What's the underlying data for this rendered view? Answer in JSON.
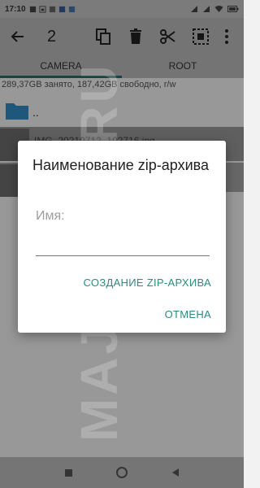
{
  "status_bar": {
    "time": "17:10",
    "icons": [
      "notification-icon",
      "calendar-icon",
      "image-icon",
      "facebook-icon",
      "vk-icon"
    ],
    "right_icons": [
      "signal-icon",
      "signal-icon",
      "wifi-icon",
      "battery-icon"
    ]
  },
  "toolbar": {
    "selected_count": "2",
    "icons": [
      "back-arrow-icon",
      "copy-icon",
      "delete-icon",
      "cut-icon",
      "select-all-icon",
      "more-vert-icon"
    ]
  },
  "tabs": [
    {
      "label": "CAMERA",
      "active": true
    },
    {
      "label": "ROOT",
      "active": false
    }
  ],
  "storage_info": "289,37GB занято, 187,42GB свободно, r/w",
  "file_list": {
    "parent_label": "..",
    "file_name": "IMG_20210712_102716.jpg"
  },
  "dialog": {
    "title": "Наименование zip-архива",
    "field_label": "Имя:",
    "field_value": "",
    "create_button": "СОЗДАНИЕ ZIP-АРХИВА",
    "cancel_button": "ОТМЕНА"
  },
  "watermark": "MAJOREX.RU",
  "colors": {
    "accent": "#2f8a80",
    "tab_indicator": "#2b6f67",
    "folder": "#2f8dc7"
  }
}
